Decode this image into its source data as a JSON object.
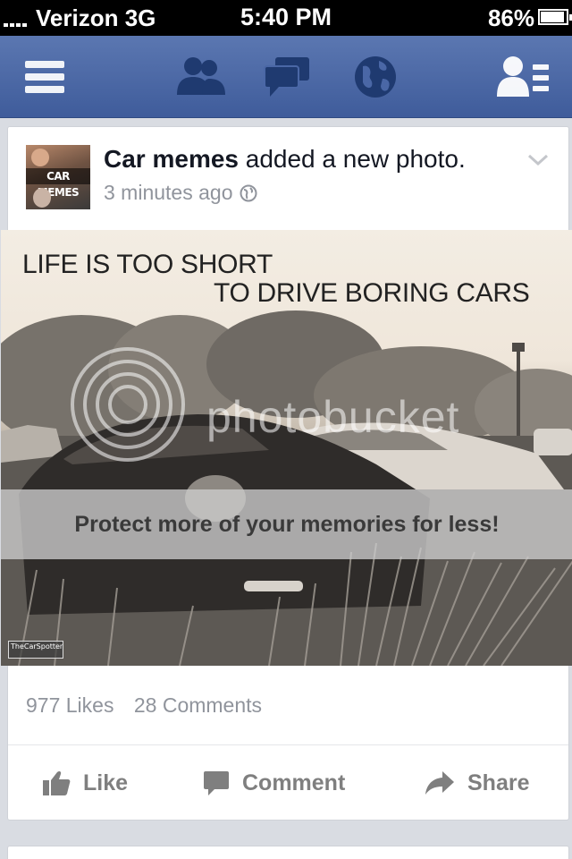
{
  "status_bar": {
    "carrier": "Verizon  3G",
    "time": "5:40 PM",
    "battery": "86%"
  },
  "nav": {
    "icons": [
      "menu-icon",
      "friend-requests-icon",
      "messages-icon",
      "notifications-globe-icon",
      "profile-list-icon"
    ]
  },
  "post": {
    "author": "Car memes",
    "action": " added a new photo.",
    "time": "3 minutes ago",
    "avatar_caption": "CAR MEMES",
    "photo": {
      "line1": "LIFE IS TOO SHORT",
      "line2": "TO DRIVE BORING CARS",
      "watermark": "photobucket",
      "banner": "Protect more of your memories for less!",
      "credit": "TheCarSpotters"
    },
    "likes": "977 Likes",
    "comments": "28 Comments",
    "actions": {
      "like": "Like",
      "comment": "Comment",
      "share": "Share"
    }
  },
  "colors": {
    "nav_blue": "#4a67a6",
    "muted_text": "#90949c",
    "action_text": "#7f7f7f"
  }
}
